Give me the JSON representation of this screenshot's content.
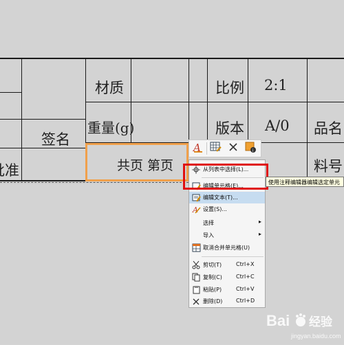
{
  "drawing": {
    "labels": {
      "material": "材质",
      "weight": "重量(g)",
      "sign": "签名",
      "approve_partial": "批准",
      "scale": "比例",
      "scale_value": "2:1",
      "version": "版本",
      "version_value": "A/0",
      "product_partial": "品名",
      "part_no_partial": "料号",
      "pages": "共页 第页"
    }
  },
  "toolbar": {
    "buttons": [
      {
        "icon": "text-style-icon"
      },
      {
        "icon": "table-edit-icon"
      },
      {
        "icon": "delete-x-icon"
      },
      {
        "icon": "cell-properties-icon"
      }
    ]
  },
  "context_menu": {
    "items": [
      {
        "label": "从列表中选择(L)...",
        "icon": "list-select-icon"
      },
      {
        "label": "编辑单元格(E)...",
        "icon": "edit-cell-icon"
      },
      {
        "label": "编辑文本(T)...",
        "icon": "edit-text-icon",
        "highlighted": true
      },
      {
        "label": "设置(S)...",
        "icon": "settings-icon"
      },
      {
        "label": "选择",
        "submenu": true
      },
      {
        "label": "导入",
        "submenu": true
      },
      {
        "label": "取消合并单元格(U)",
        "icon": "unmerge-cells-icon"
      },
      {
        "label": "剪切(T)",
        "shortcut": "Ctrl+X",
        "icon": "cut-icon"
      },
      {
        "label": "复制(C)",
        "shortcut": "Ctrl+C",
        "icon": "copy-icon"
      },
      {
        "label": "粘贴(P)",
        "shortcut": "Ctrl+V",
        "icon": "paste-icon"
      },
      {
        "label": "删除(D)",
        "shortcut": "Ctrl+D",
        "icon": "delete-icon"
      }
    ]
  },
  "tooltip": "使用注释编辑器编辑选定单元",
  "watermark": {
    "text": "Bai",
    "suffix": "经验",
    "url": "jingyan.baidu.com"
  },
  "colors": {
    "selection": "#f0a04b",
    "highlight": "#e01010",
    "menu_hover": "#c6dcf0"
  }
}
